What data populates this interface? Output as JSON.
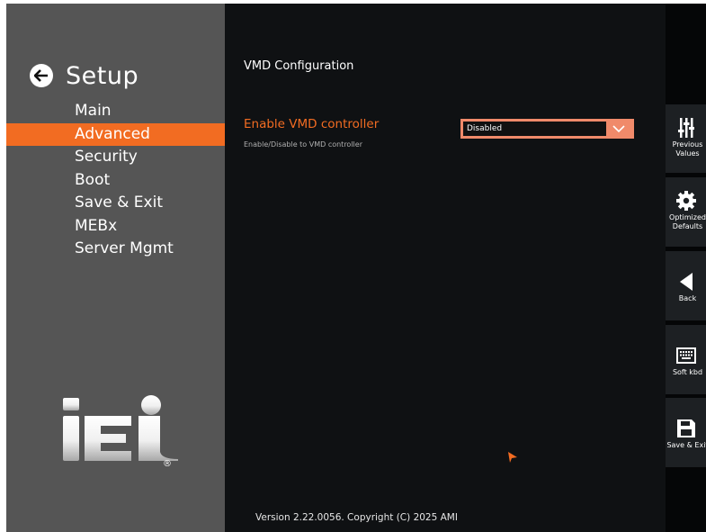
{
  "header": {
    "title": "Setup"
  },
  "nav": {
    "items": [
      {
        "label": "Main"
      },
      {
        "label": "Advanced"
      },
      {
        "label": "Security"
      },
      {
        "label": "Boot"
      },
      {
        "label": "Save & Exit"
      },
      {
        "label": "MEBx"
      },
      {
        "label": "Server Mgmt"
      }
    ],
    "active_index": 1
  },
  "logo": {
    "text": "iEi",
    "registered": "®"
  },
  "content": {
    "section_title": "VMD Configuration",
    "option": {
      "label": "Enable VMD controller",
      "help": "Enable/Disable to VMD controller",
      "value": "Disabled"
    }
  },
  "footer": {
    "version": "Version 2.22.0056. Copyright (C) 2025 AMI"
  },
  "sidebar_right": {
    "buttons": [
      {
        "label_line1": "Previous",
        "label_line2": "Values",
        "icon": "sliders-icon"
      },
      {
        "label_line1": "Optimized",
        "label_line2": "Defaults",
        "icon": "gear-icon"
      },
      {
        "label_line1": "Back",
        "label_line2": "",
        "icon": "triangle-left-icon"
      },
      {
        "label_line1": "Soft kbd",
        "label_line2": "",
        "icon": "keyboard-icon"
      },
      {
        "label_line1": "Save & Exit",
        "label_line2": "",
        "icon": "floppy-icon"
      }
    ]
  },
  "colors": {
    "accent": "#f26c22",
    "dropdown_border": "#f08a6a",
    "left_panel": "#555555",
    "main_bg": "#0f1113",
    "right_button_bg": "#1d2023"
  }
}
